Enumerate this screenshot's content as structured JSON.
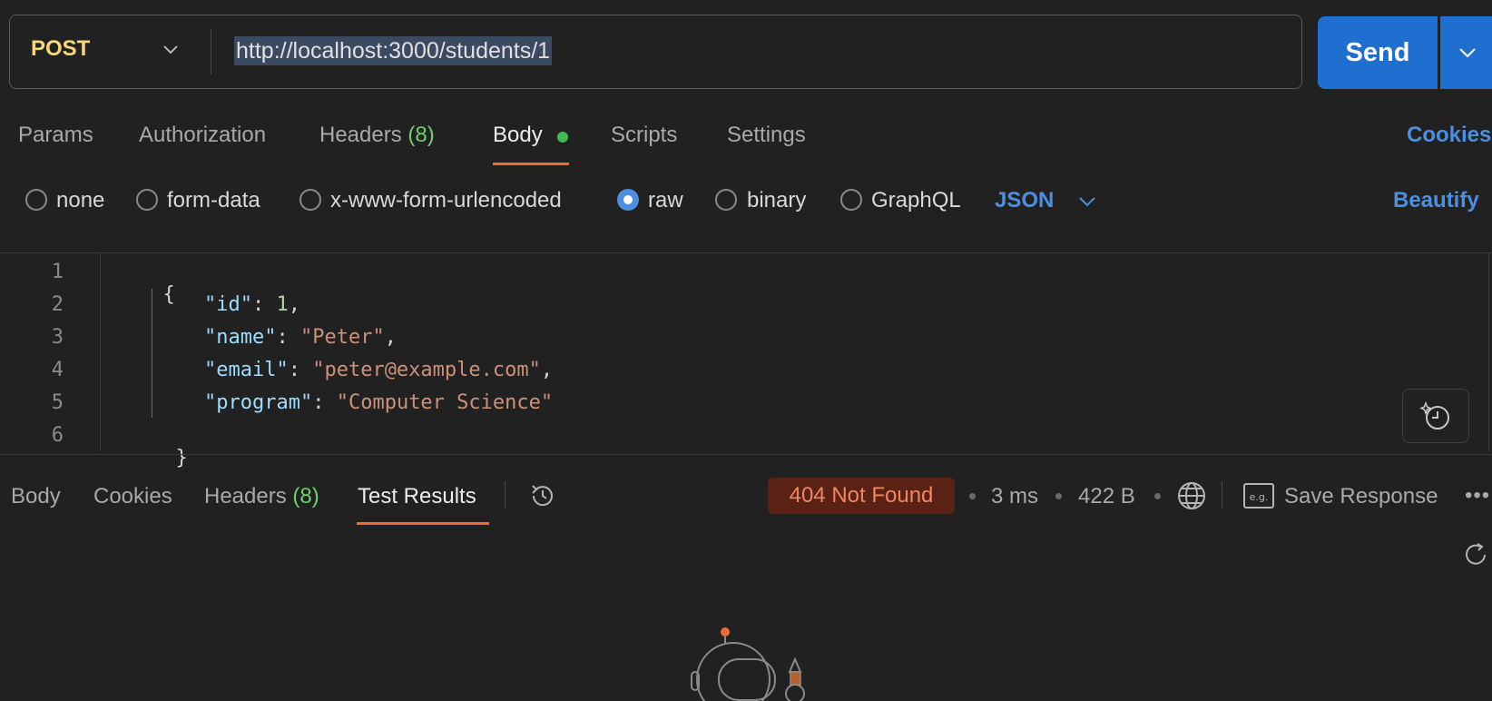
{
  "request": {
    "method": "POST",
    "url": "http://localhost:3000/students/1",
    "send_label": "Send"
  },
  "request_tabs": {
    "params": "Params",
    "authorization": "Authorization",
    "headers": "Headers",
    "headers_count": "(8)",
    "body": "Body",
    "scripts": "Scripts",
    "settings": "Settings",
    "cookies": "Cookies"
  },
  "body_types": {
    "none": "none",
    "form_data": "form-data",
    "urlencoded": "x-www-form-urlencoded",
    "raw": "raw",
    "binary": "binary",
    "graphql": "GraphQL",
    "selected": "raw",
    "format": "JSON",
    "beautify": "Beautify"
  },
  "editor": {
    "line_numbers": [
      "1",
      "2",
      "3",
      "4",
      "5",
      "6"
    ],
    "lines": {
      "l1": "{",
      "l2_key": "\"id\"",
      "l2_val": "1",
      "l3_key": "\"name\"",
      "l3_val": "\"Peter\"",
      "l4_key": "\"email\"",
      "l4_val": "\"peter@example.com\"",
      "l5_key": "\"program\"",
      "l5_val": "\"Computer Science\"",
      "l6": "}"
    }
  },
  "response": {
    "tabs": {
      "body": "Body",
      "cookies": "Cookies",
      "headers": "Headers",
      "headers_count": "(8)",
      "test_results": "Test Results"
    },
    "status": "404 Not Found",
    "time": "3 ms",
    "size": "422 B",
    "save_label": "Save Response",
    "more": "•••"
  },
  "colors": {
    "accent_blue": "#1f6fd1",
    "tab_underline": "#ef6c3a",
    "status_error_bg": "#5a2214",
    "status_error_text": "#f08566"
  },
  "icons": [
    "chevron-down-icon",
    "history-icon",
    "globe-icon",
    "example-icon",
    "refresh-icon",
    "ai-assist-icon",
    "astronaut-illustration"
  ]
}
